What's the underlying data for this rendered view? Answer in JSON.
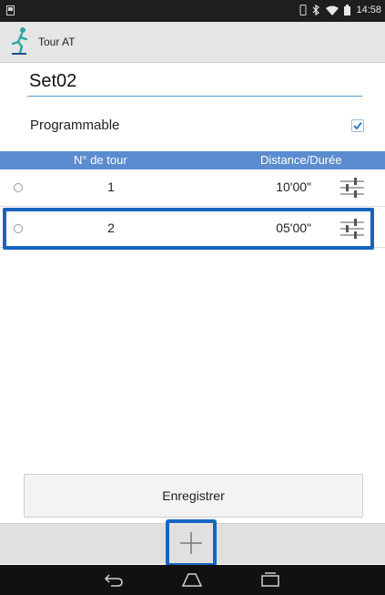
{
  "status_bar": {
    "time": "14:58",
    "icons": [
      "notification-icon",
      "vibrate-icon",
      "bluetooth-icon",
      "wifi-icon",
      "battery-icon"
    ]
  },
  "action_bar": {
    "app_icon": "runner-icon",
    "title": "Tour AT"
  },
  "set_name": {
    "value": "Set02"
  },
  "programmable": {
    "label": "Programmable",
    "checked": true
  },
  "table": {
    "headers": [
      "N° de tour",
      "Distance/Durée"
    ],
    "rows": [
      {
        "number": "1",
        "duration": "10'00\""
      },
      {
        "number": "2",
        "duration": "05'00\""
      }
    ],
    "adjust_icon": "sliders-icon"
  },
  "buttons": {
    "save_label": "Enregistrer",
    "add_icon": "plus-icon"
  },
  "nav_bar": {
    "icons": [
      "back-icon",
      "home-icon",
      "recent-apps-icon"
    ]
  },
  "colors": {
    "header_blue": "#5b8ccf",
    "highlight_blue": "#1565c0",
    "input_underline": "#5b9bd5"
  }
}
